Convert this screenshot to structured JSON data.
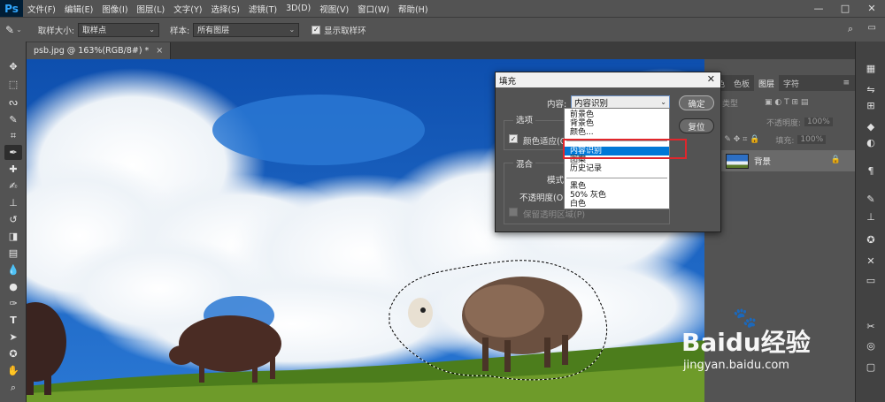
{
  "app": {
    "logo": "Ps",
    "menu": [
      "文件(F)",
      "编辑(E)",
      "图像(I)",
      "图层(L)",
      "文字(Y)",
      "选择(S)",
      "滤镜(T)",
      "3D(D)",
      "视图(V)",
      "窗口(W)",
      "帮助(H)"
    ],
    "window_controls": [
      "—",
      "□",
      "✕"
    ]
  },
  "options_bar": {
    "sample_size_label": "取样大小:",
    "sample_size_value": "取样点",
    "sample_label": "样本:",
    "sample_value": "所有图层",
    "show_ring_label": "显示取样环"
  },
  "document": {
    "tab_title": "psb.jpg @ 163%(RGB/8#) *",
    "close": "×"
  },
  "layers_panel": {
    "tabs": [
      "颜色",
      "色板",
      "图层",
      "字符"
    ],
    "active_tab": "图层",
    "kind_filter": "类型",
    "opacity_label": "不透明度:",
    "opacity_value": "100%",
    "fill_label": "填充:",
    "fill_value": "100%",
    "layer_name": "背景"
  },
  "dialog": {
    "title": "填充",
    "content_label": "内容:",
    "content_value": "内容识别",
    "ok_button": "确定",
    "reset_button": "复位",
    "options_label": "选项",
    "color_adapt_label": "颜色适应(C)",
    "blend_label": "混合",
    "mode_label": "模式:",
    "opacity_label": "不透明度(O):",
    "preserve_transparency_label": "保留透明区域(P)"
  },
  "dropdown": {
    "items": [
      "前景色",
      "背景色",
      "颜色...",
      "内容识别",
      "图案",
      "历史记录",
      "黑色",
      "50% 灰色",
      "白色"
    ],
    "selected": "内容识别"
  },
  "watermark": {
    "text": "Baidu经验",
    "url": "jingyan.baidu.com"
  }
}
